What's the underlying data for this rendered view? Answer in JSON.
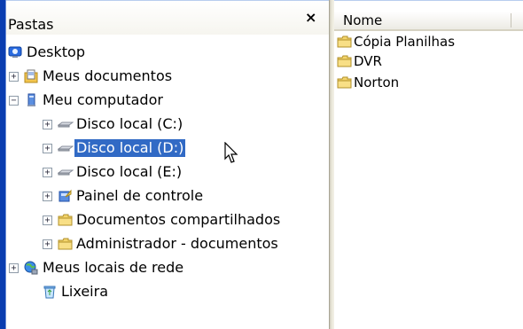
{
  "folders_pane": {
    "title": "Pastas",
    "close_glyph": "×"
  },
  "tree": {
    "items": [
      {
        "label": "Desktop",
        "icon": "desktop-icon",
        "expander": ""
      },
      {
        "label": "Meus documentos",
        "icon": "documents-icon",
        "expander": "+"
      },
      {
        "label": "Meu computador",
        "icon": "computer-icon",
        "expander": "−"
      },
      {
        "label": "Disco local (C:)",
        "icon": "drive-icon",
        "expander": "+"
      },
      {
        "label": "Disco local (D:)",
        "icon": "drive-icon",
        "expander": "+",
        "selected": true
      },
      {
        "label": "Disco local (E:)",
        "icon": "drive-icon",
        "expander": "+"
      },
      {
        "label": "Painel de controle",
        "icon": "control-panel-icon",
        "expander": "+"
      },
      {
        "label": "Documentos compartilhados",
        "icon": "folder-icon",
        "expander": "+"
      },
      {
        "label": "Administrador - documentos",
        "icon": "folder-icon",
        "expander": "+"
      },
      {
        "label": "Meus locais de rede",
        "icon": "network-icon",
        "expander": "+"
      },
      {
        "label": "Lixeira",
        "icon": "recycle-bin-icon",
        "expander": ""
      }
    ]
  },
  "list": {
    "column_name": "Nome",
    "items": [
      {
        "label": "Cópia Planilhas",
        "icon": "folder-icon"
      },
      {
        "label": "DVR",
        "icon": "folder-icon"
      },
      {
        "label": "Norton",
        "icon": "folder-icon"
      }
    ]
  },
  "colors": {
    "selection": "#316ac5",
    "folder": "#f3d46b",
    "sidebar_blue": "#0a3db0"
  }
}
